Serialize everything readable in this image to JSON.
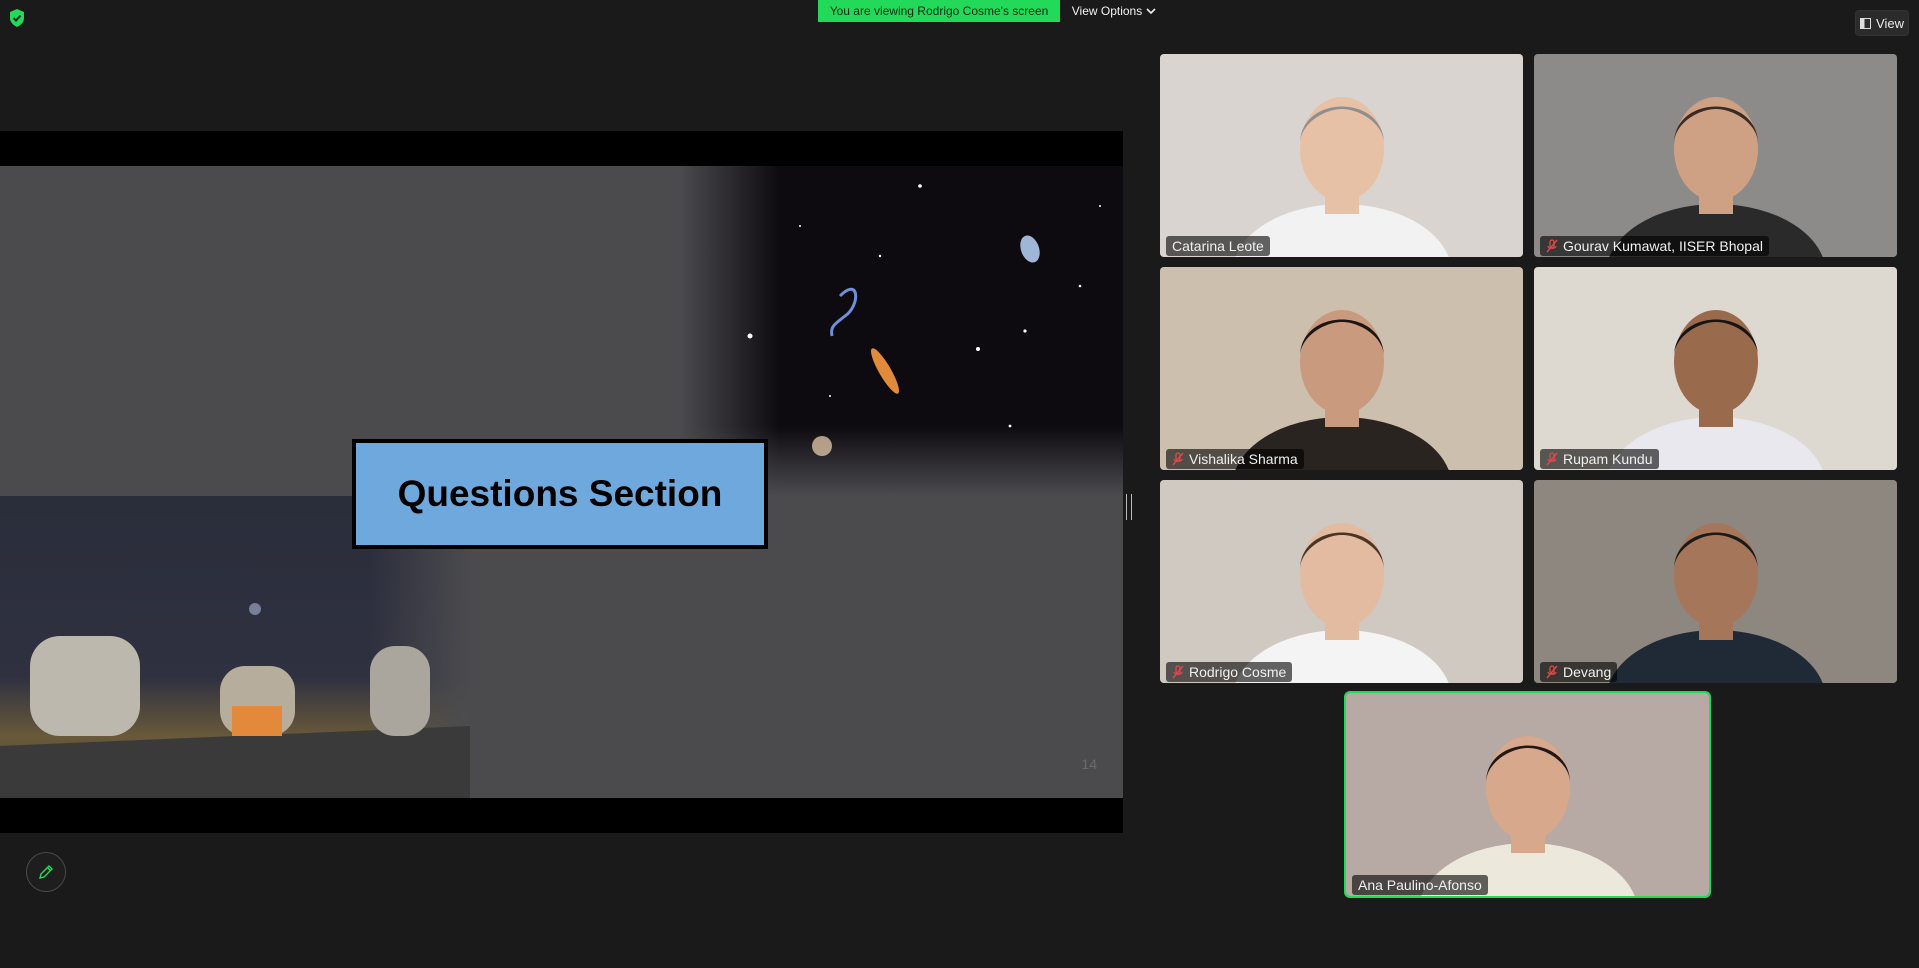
{
  "banner": {
    "viewing_text": "You are viewing Rodrigo Cosme's screen",
    "view_options_label": "View Options",
    "view_label": "View"
  },
  "slide": {
    "title": "Questions Section",
    "number": "14"
  },
  "participants": [
    {
      "name": "Catarina Leote",
      "muted": false,
      "active": false,
      "bg": "#d9d4cf",
      "skin": "#e7c1a6",
      "hair": "#8f8f8f",
      "shirt": "#f2f2f2"
    },
    {
      "name": "Gourav Kumawat, IISER Bhopal",
      "muted": true,
      "active": false,
      "bg": "#8c8b89",
      "skin": "#cfa184",
      "hair": "#3c2b22",
      "shirt": "#2a2a2a"
    },
    {
      "name": "Vishalika Sharma",
      "muted": true,
      "active": false,
      "bg": "#cdbfae",
      "skin": "#c99a7e",
      "hair": "#1c1512",
      "shirt": "#2a2420"
    },
    {
      "name": "Rupam Kundu",
      "muted": true,
      "active": false,
      "bg": "#ddd8d0",
      "skin": "#9a6a4c",
      "hair": "#141414",
      "shirt": "#e8e8ee"
    },
    {
      "name": "Rodrigo Cosme",
      "muted": true,
      "active": false,
      "bg": "#cfc9c1",
      "skin": "#e2bba0",
      "hair": "#4a3526",
      "shirt": "#f4f4f4"
    },
    {
      "name": "Devang",
      "muted": true,
      "active": false,
      "bg": "#8d8780",
      "skin": "#a6765a",
      "hair": "#1a1a1a",
      "shirt": "#1f2a36"
    },
    {
      "name": "Ana Paulino-Afonso",
      "muted": false,
      "active": true,
      "bg": "#b7a9a4",
      "skin": "#d8a88c",
      "hair": "#221815",
      "shirt": "#ece8dc"
    }
  ]
}
